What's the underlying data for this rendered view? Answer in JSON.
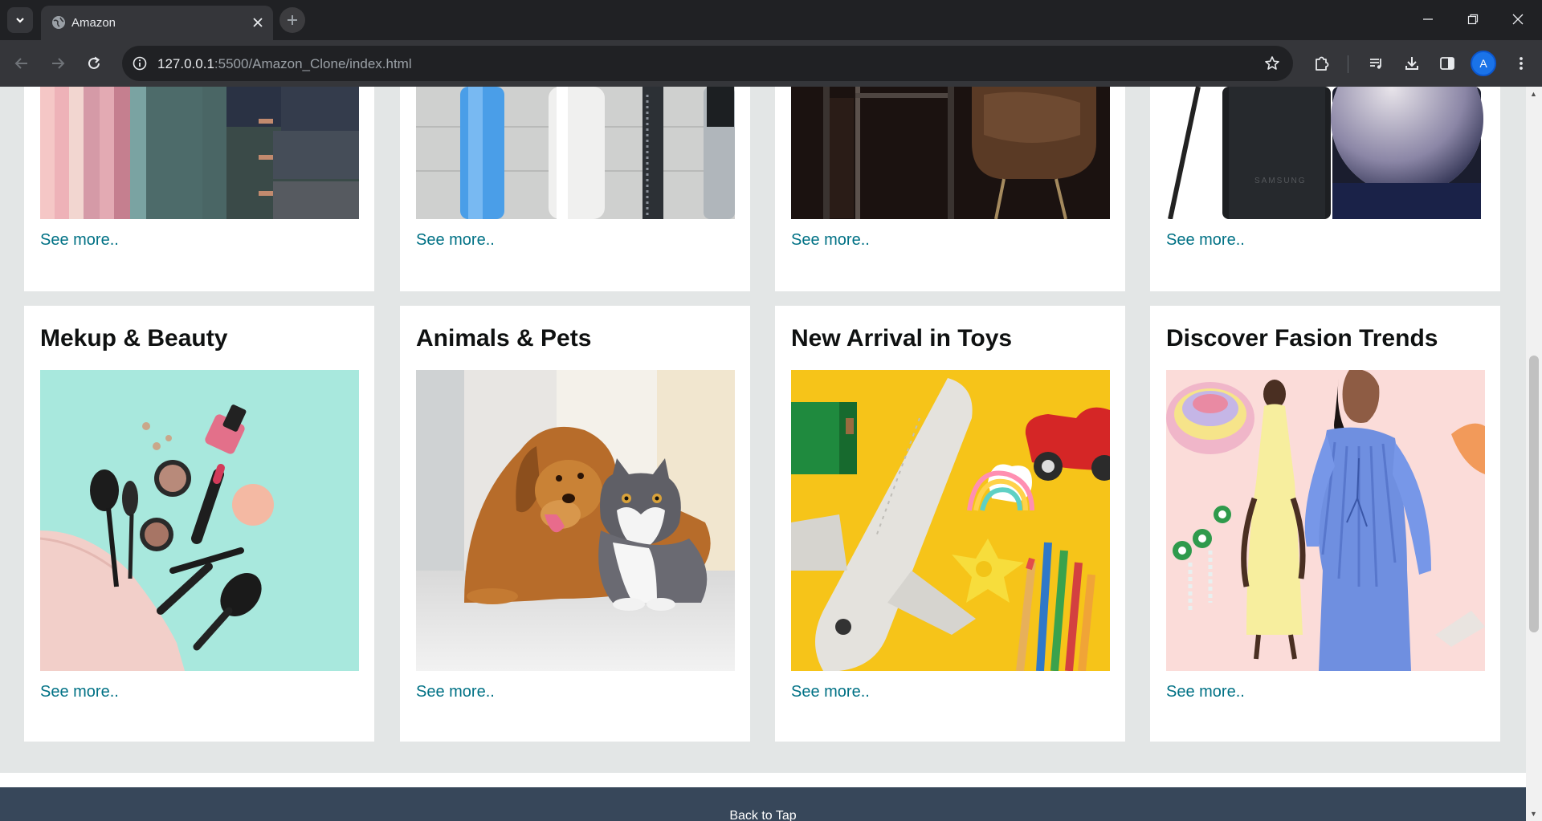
{
  "browser": {
    "tab_title": "Amazon",
    "url_host": "127.0.0.1",
    "url_rest": ":5500/Amazon_Clone/index.html",
    "profile_initial": "A"
  },
  "top_row_cards": [
    {
      "link": "See more..",
      "image": "fashion-fabrics-photo"
    },
    {
      "link": "See more..",
      "image": "home-appliances-photo"
    },
    {
      "link": "See more..",
      "image": "furniture-chair-photo"
    },
    {
      "link": "See more..",
      "image": "samsung-phone-photo"
    }
  ],
  "bottom_row_cards": [
    {
      "title": "Mekup & Beauty",
      "link": "See more..",
      "image": "makeup-products-photo"
    },
    {
      "title": "Animals & Pets",
      "link": "See more..",
      "image": "dog-and-cat-photo"
    },
    {
      "title": "New Arrival in Toys",
      "link": "See more..",
      "image": "toys-airplane-photo"
    },
    {
      "title": "Discover Fasion Trends",
      "link": "See more..",
      "image": "fashion-models-photo"
    }
  ],
  "footer": {
    "back_to_top": "Back to Tap"
  },
  "colors": {
    "link": "#007185",
    "page_bg": "#e3e6e6",
    "footer_bg": "#37475a"
  }
}
